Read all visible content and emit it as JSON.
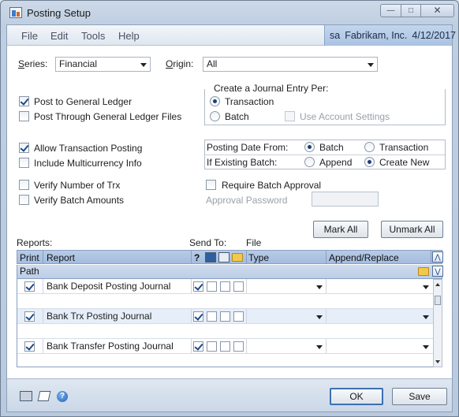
{
  "window": {
    "title": "Posting Setup"
  },
  "menu": [
    "File",
    "Edit",
    "Tools",
    "Help"
  ],
  "company": {
    "user": "sa",
    "name": "Fabrikam, Inc.",
    "date": "4/12/2017"
  },
  "series": {
    "label_prefix": "S",
    "label_rest": "eries:",
    "value": "Financial"
  },
  "origin": {
    "label_prefix": "O",
    "label_rest": "rigin:",
    "value": "All"
  },
  "options": {
    "post_gl": "Post to General Ledger",
    "post_through_gl": "Post Through General Ledger Files",
    "allow_trx_posting": "Allow Transaction Posting",
    "include_multicurrency": "Include Multicurrency Info",
    "verify_num_trx": "Verify Number of Trx",
    "verify_batch_amounts": "Verify Batch Amounts",
    "require_batch_approval": "Require Batch Approval",
    "approval_password": "Approval Password"
  },
  "journal_entry": {
    "title": "Create a Journal Entry Per:",
    "transaction": "Transaction",
    "batch": "Batch",
    "use_account_settings": "Use Account Settings"
  },
  "posting_date": {
    "label": "Posting Date From:",
    "batch": "Batch",
    "transaction": "Transaction",
    "existing_label": "If Existing Batch:",
    "append": "Append",
    "create_new": "Create New"
  },
  "buttons": {
    "mark_all": "Mark All",
    "unmark_all": "Unmark All",
    "ok": "OK",
    "save": "Save"
  },
  "grid": {
    "reports_label": "Reports:",
    "send_to_label": "Send To:",
    "file_label": "File",
    "headers": {
      "print": "Print",
      "report": "Report",
      "help": "?",
      "type": "Type",
      "append_replace": "Append/Replace"
    },
    "path_label": "Path",
    "rows": [
      {
        "name": "Bank Deposit Posting Journal"
      },
      {
        "name": "Bank Trx Posting Journal"
      },
      {
        "name": "Bank Transfer Posting Journal"
      }
    ]
  }
}
